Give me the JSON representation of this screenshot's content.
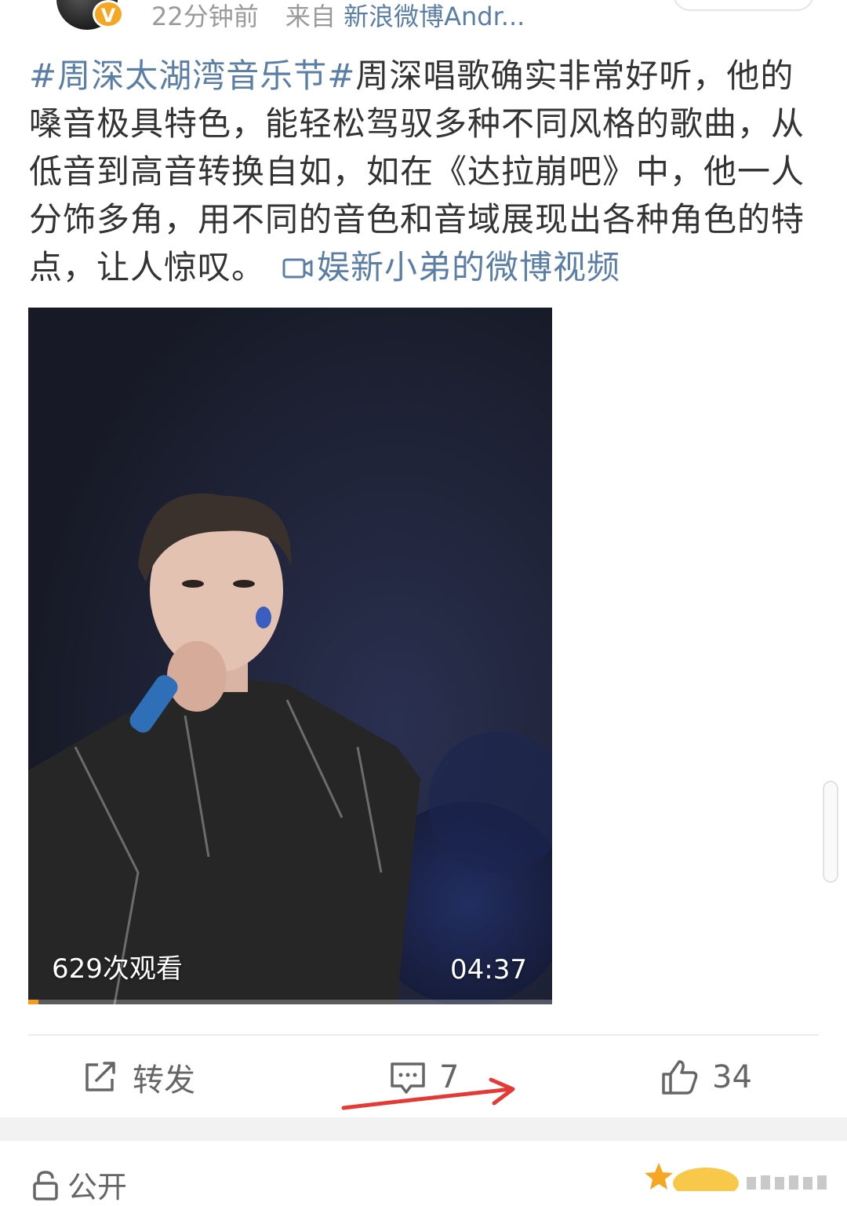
{
  "header": {
    "verified_badge": "V",
    "time": "22分钟前",
    "source_prefix": "来自",
    "source": "新浪微博Andr..."
  },
  "post": {
    "hashtag": "#周深太湖湾音乐节#",
    "body": "周深唱歌确实非常好听，他的嗓音极具特色，能轻松驾驭多种不同风格的歌曲，从低音到高音转换自如，如在《达拉崩吧》中，他一人分饰多角，用不同的音色和音域展现出各种角色的特点，让人惊叹。",
    "video_link": "娱新小弟的微博视频"
  },
  "video": {
    "views": "629次观看",
    "duration": "04:37",
    "progress": 0.02
  },
  "actions": {
    "repost_label": "转发",
    "comment_count": "7",
    "like_count": "34"
  },
  "footer": {
    "visibility": "公开"
  },
  "icons": {
    "repost": "share-icon",
    "comment": "comment-icon",
    "like": "thumbs-up-icon",
    "video": "video-camera-icon",
    "lock": "lock-icon"
  },
  "colors": {
    "link": "#5b7ea6",
    "badge": "#f5a623",
    "annotation_arrow": "#e53935"
  }
}
